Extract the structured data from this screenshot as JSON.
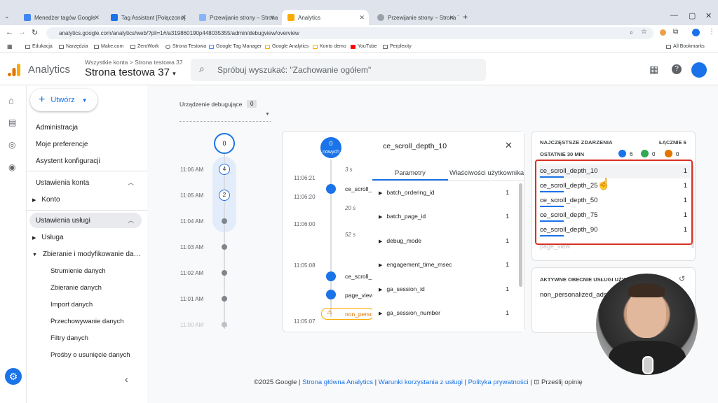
{
  "tabs": [
    {
      "label": "Menedżer tagów Google",
      "color": "#4285f4"
    },
    {
      "label": "Tag Assistant [Połączono]",
      "color": "#1a73e8"
    },
    {
      "label": "Przewijanie strony – Strona Tes…",
      "color": "#5f6368"
    },
    {
      "label": "Analytics",
      "color": "#f9ab00"
    },
    {
      "label": "Przewijanie strony – Strona Tes…",
      "color": "#5f6368"
    }
  ],
  "url": "analytics.google.com/analytics/web/?pli=1#/a319860190p448035355/admin/debugview/overview",
  "bookmarks": [
    "Edukacja",
    "Narzędzia",
    "Make.com",
    "ZeroWork",
    "Strona Testowa",
    "Google Tag Manager",
    "Google Analytics",
    "Konto demo",
    "YouTube",
    "Perplexity"
  ],
  "all_bookmarks": "All Bookmarks",
  "ga": {
    "product": "Analytics",
    "breadcrumb": "Wszystkie konta > Strona testowa 37",
    "property": "Strona testowa 37",
    "search_placeholder": "Spróbuj wyszukać: \"Zachowanie ogółem\""
  },
  "create_button": "Utwórz",
  "nav": {
    "admin": "Administracja",
    "prefs": "Moje preferencje",
    "assistant": "Asystent konfiguracji",
    "account_settings": "Ustawienia konta",
    "account": "Konto",
    "service_settings": "Ustawienia usługi",
    "service": "Usługa",
    "collection": "Zbieranie i modyfikowanie da…",
    "sub": [
      "Strumienie danych",
      "Zbieranie danych",
      "Import danych",
      "Przechowywanie danych",
      "Filtry danych",
      "Prośby o usunięcie danych"
    ]
  },
  "debug": {
    "device_label": "Urządzenie debugujące",
    "device_count": "0",
    "minutes": [
      "11:06 AM",
      "11:05 AM",
      "11:04 AM",
      "11:03 AM",
      "11:02 AM",
      "11:01 AM",
      "11:00 AM"
    ],
    "minute_counts": {
      "top": "0",
      "a": "4",
      "b": "2"
    }
  },
  "seconds": {
    "new_count": "0",
    "new_label": "nowych",
    "times": [
      "11:06:21",
      "11:06:20",
      "11:06:00",
      "11:05:08",
      "11:05:07"
    ],
    "gaps": [
      "3 s",
      "20 s",
      "52 s"
    ],
    "events": [
      "ce_scroll_…",
      "ce_scroll_…",
      "page_view",
      "non_perso…"
    ]
  },
  "detail": {
    "title": "ce_scroll_depth_10",
    "tab_params": "Parametry",
    "tab_user": "Właściwości użytkownika",
    "params": [
      {
        "name": "batch_ordering_id",
        "n": "1"
      },
      {
        "name": "batch_page_id",
        "n": "1"
      },
      {
        "name": "debug_mode",
        "n": "1"
      },
      {
        "name": "engagement_time_msec",
        "n": "1"
      },
      {
        "name": "ga_session_id",
        "n": "1"
      },
      {
        "name": "ga_session_number",
        "n": "1"
      }
    ]
  },
  "top_events": {
    "title": "NAJCZĘSTSZE ZDARZENIA",
    "total": "ŁĄCZNIE 6",
    "period": "OSTATNIE 30 MIN",
    "counts": {
      "blue": "6",
      "green": "0",
      "orange": "0"
    },
    "rows": [
      {
        "name": "ce_scroll_depth_10",
        "n": "1"
      },
      {
        "name": "ce_scroll_depth_25",
        "n": "1"
      },
      {
        "name": "ce_scroll_depth_50",
        "n": "1"
      },
      {
        "name": "ce_scroll_depth_75",
        "n": "1"
      },
      {
        "name": "ce_scroll_depth_90",
        "n": "1"
      }
    ],
    "faded": "page_view"
  },
  "active": {
    "title": "AKTYWNE OBECNIE USŁUGI UŻYT…",
    "value": "non_personalized_ads"
  },
  "footer": {
    "copy": "©2025 Google",
    "home": "Strona główna Analytics",
    "terms": "Warunki korzystania z usługi",
    "privacy": "Polityka prywatności",
    "feedback": "Prześlij opinię"
  },
  "colors": {
    "blue": "#1a73e8",
    "red": "#d93025",
    "orange": "#f9ab00"
  }
}
